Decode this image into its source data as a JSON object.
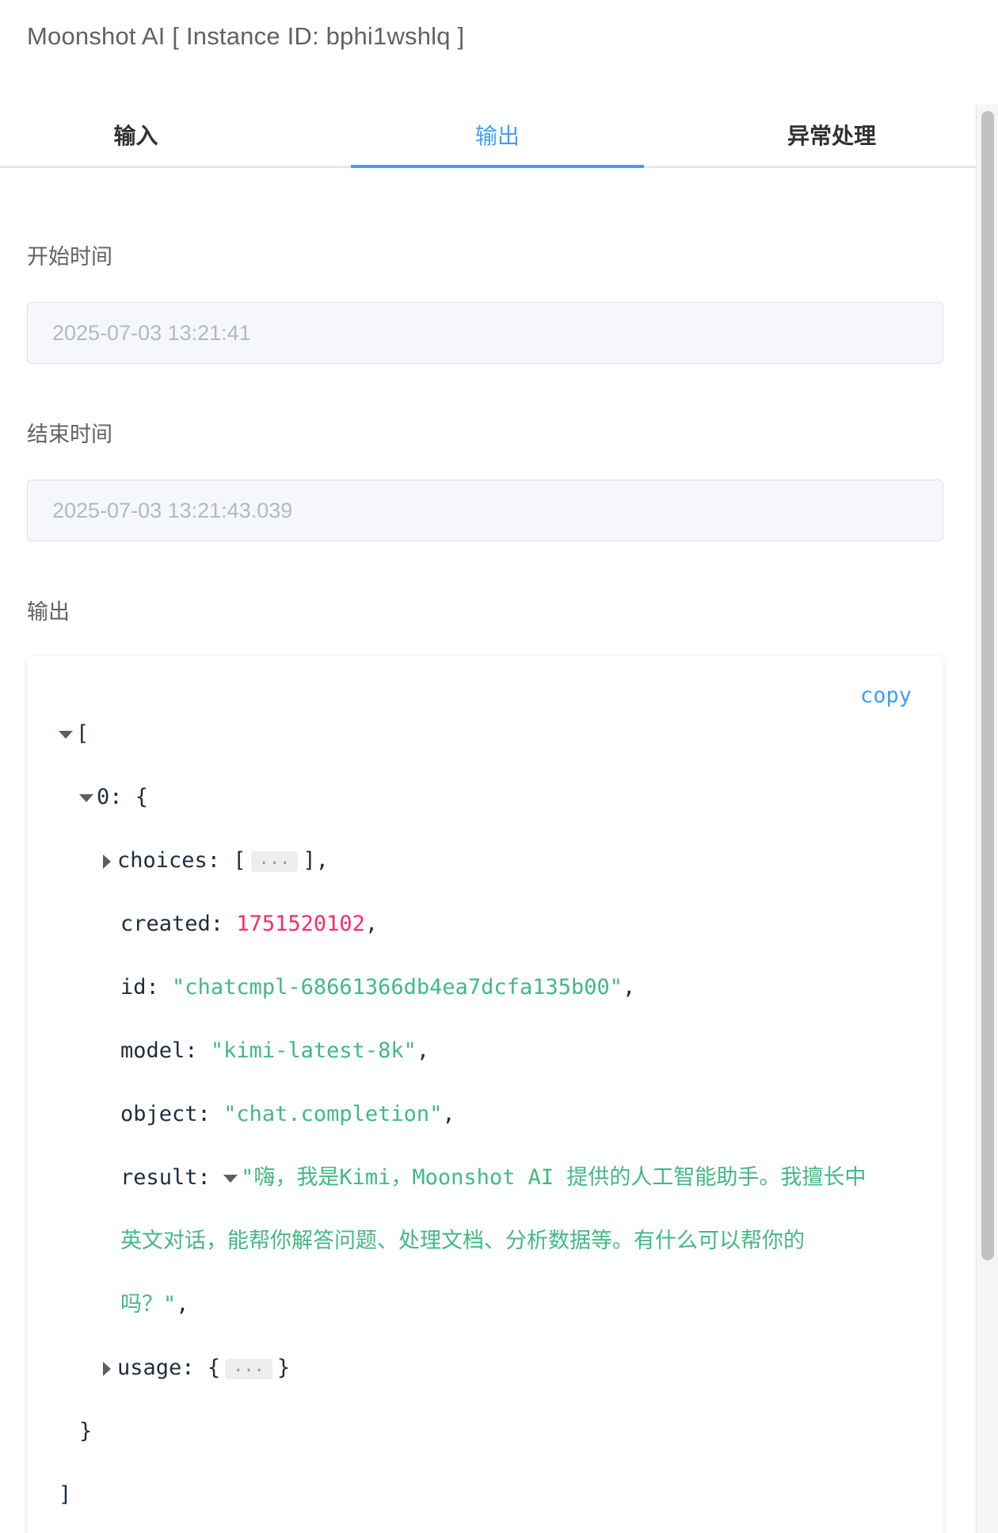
{
  "header": {
    "title": "Moonshot AI [ Instance ID: bphi1wshlq ]"
  },
  "tabs": [
    {
      "label": "输入",
      "active": false
    },
    {
      "label": "输出",
      "active": true
    },
    {
      "label": "异常处理",
      "active": false
    }
  ],
  "form": {
    "start_label": "开始时间",
    "start_value": "2025-07-03 13:21:41",
    "end_label": "结束时间",
    "end_value": "2025-07-03 13:21:43.039",
    "output_label": "输出"
  },
  "json_viewer": {
    "copy_label": "copy",
    "open_bracket": "[",
    "close_bracket": "]",
    "item_index": "0",
    "item_open": "{",
    "item_close": "}",
    "ellipsis": "...",
    "fields": {
      "choices_key": "choices",
      "created_key": "created",
      "created_value": "1751520102",
      "id_key": "id",
      "id_value": "\"chatcmpl-68661366db4ea7dcfa135b00\"",
      "model_key": "model",
      "model_value": "\"kimi-latest-8k\"",
      "object_key": "object",
      "object_value": "\"chat.completion\"",
      "result_key": "result",
      "result_line1": "\"嗨，我是Kimi，Moonshot AI 提供的人工智能助手。我擅长中",
      "result_line2": "英文对话，能帮你解答问题、处理文档、分析数据等。有什么可以帮你的",
      "result_line3": "吗？\"",
      "usage_key": "usage"
    }
  },
  "colors": {
    "accent": "#409eff",
    "string": "#42b983",
    "number": "#ff2a6d"
  }
}
